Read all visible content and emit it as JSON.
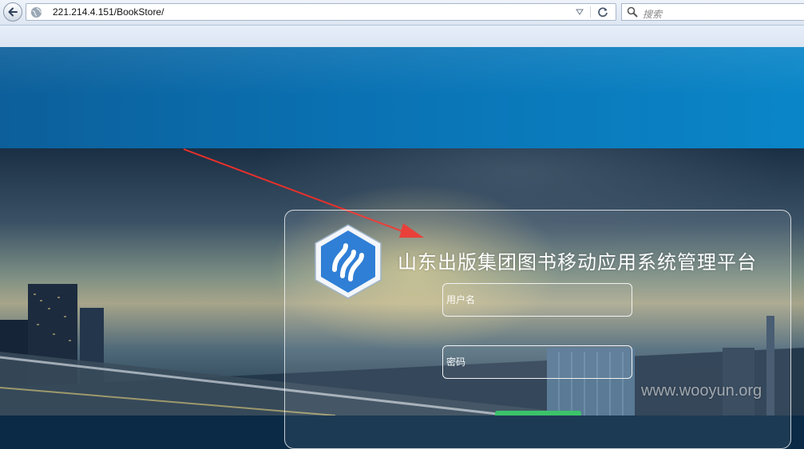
{
  "browser": {
    "url": "221.214.4.151/BookStore/",
    "search_placeholder": "搜索"
  },
  "page": {
    "system_title": "山东出版集团图书移动应用系统管理平台",
    "login": {
      "username_placeholder": "用户名",
      "password_placeholder": "密码"
    },
    "watermark": "www.wooyun.org"
  },
  "icons": {
    "back": "back-arrow-icon",
    "site": "globe-icon",
    "dropdown": "dropdown-triangle-icon",
    "reload": "reload-icon",
    "search": "magnifier-icon",
    "logo": "hexagon-logo-icon"
  },
  "colors": {
    "header_band": "#0a72b3",
    "annotation_arrow": "#e8302a",
    "submit_button": "#3cc36b",
    "logo_blue": "#2f7fd6"
  }
}
